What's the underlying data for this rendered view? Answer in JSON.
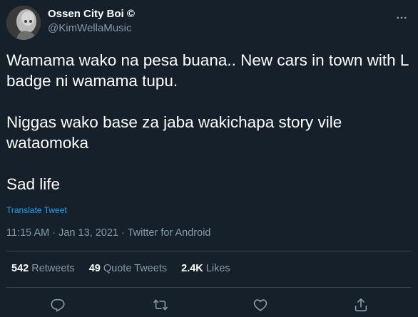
{
  "tweet": {
    "display_name": "Ossen City Boi ©",
    "handle": "@KimWellaMusic",
    "paragraphs": [
      "Wamama wako na pesa buana.. New cars in town with L badge ni wamama tupu.",
      "Niggas wako base za jaba wakichapa story vile wataomoka",
      "Sad life"
    ],
    "translate_label": "Translate Tweet",
    "time": "11:15 AM",
    "date": "Jan 13, 2021",
    "source": "Twitter for Android",
    "separator": "·"
  },
  "stats": {
    "retweets_count": "542",
    "retweets_label": "Retweets",
    "quotes_count": "49",
    "quotes_label": "Quote Tweets",
    "likes_count": "2.4K",
    "likes_label": "Likes"
  },
  "icons": {
    "more": "more-icon",
    "reply": "reply-icon",
    "retweet": "retweet-icon",
    "like": "like-icon",
    "share": "share-icon"
  },
  "colors": {
    "background": "#15202b",
    "text": "#ffffff",
    "secondary": "#8899a6",
    "accent": "#1da1f2",
    "divider": "#38444d"
  }
}
